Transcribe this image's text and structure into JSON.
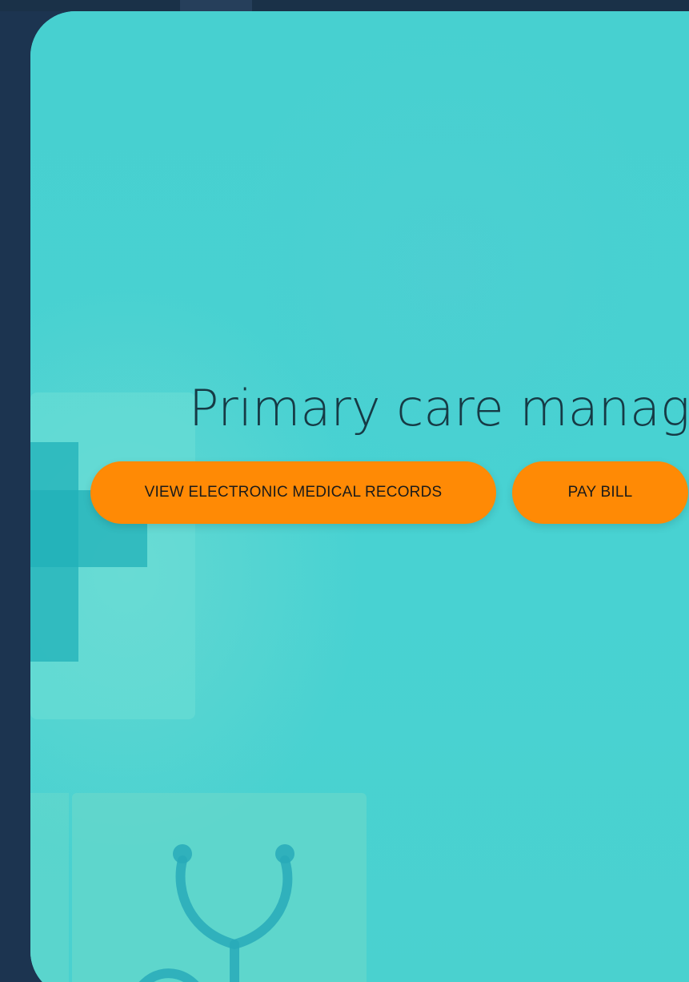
{
  "hero": {
    "headline": "Primary care manag",
    "buttons": {
      "view_records": "VIEW ELECTRONIC MEDICAL RECORDS",
      "pay_bill": "PAY BILL"
    }
  },
  "colors": {
    "page_background": "#1c3450",
    "card_background": "#48d1d1",
    "button": "#ff8a05",
    "headline_text": "#163a45",
    "button_text": "#1a1a1a"
  },
  "icons": {
    "background_decorations": [
      "medical-cross-icon",
      "stethoscope-icon"
    ]
  }
}
